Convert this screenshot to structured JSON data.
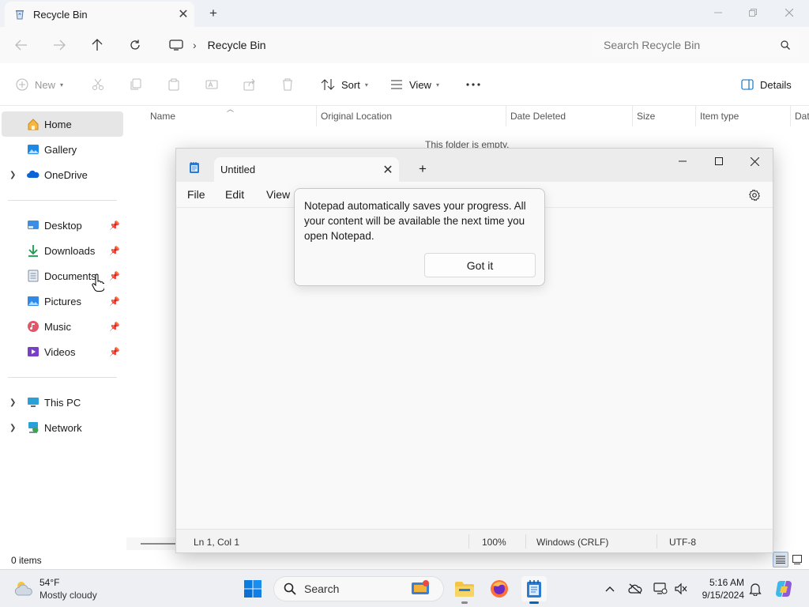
{
  "explorer": {
    "tab_title": "Recycle Bin",
    "breadcrumb": "Recycle Bin",
    "search_placeholder": "Search Recycle Bin",
    "toolbar": {
      "new": "New",
      "sort": "Sort",
      "view": "View",
      "details": "Details"
    },
    "sidebar": {
      "home": "Home",
      "gallery": "Gallery",
      "onedrive": "OneDrive",
      "desktop": "Desktop",
      "downloads": "Downloads",
      "documents": "Documents",
      "pictures": "Pictures",
      "music": "Music",
      "videos": "Videos",
      "this_pc": "This PC",
      "network": "Network"
    },
    "columns": [
      "Name",
      "Original Location",
      "Date Deleted",
      "Size",
      "Item type",
      "Dat"
    ],
    "empty_message": "This folder is empty.",
    "item_count": "0 items"
  },
  "notepad": {
    "tab_title": "Untitled",
    "menu": {
      "file": "File",
      "edit": "Edit",
      "view": "View"
    },
    "content": "",
    "status": {
      "position": "Ln 1, Col 1",
      "zoom": "100%",
      "line_ending": "Windows (CRLF)",
      "encoding": "UTF-8"
    },
    "teaching_tip": {
      "message": "Notepad automatically saves your progress. All your content will be available the next time you open Notepad.",
      "button": "Got it"
    }
  },
  "taskbar": {
    "weather_temp": "54°F",
    "weather_desc": "Mostly cloudy",
    "search_label": "Search",
    "time": "5:16 AM",
    "date": "9/15/2024"
  },
  "colors": {
    "accent": "#0067c0",
    "folder": "#f4c542",
    "onedrive": "#0a64d6"
  }
}
